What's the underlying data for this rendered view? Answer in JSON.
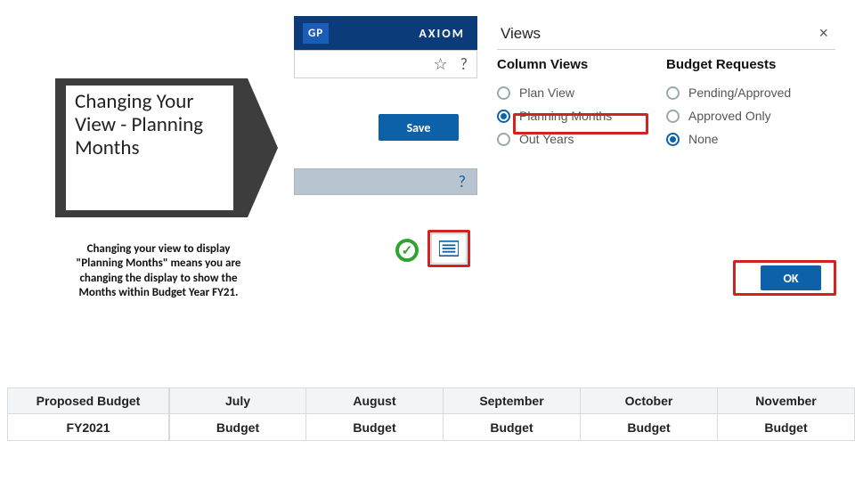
{
  "callout": {
    "title": "Changing Your View - Planning Months",
    "description": "Changing your view to display \"Planning Months\" means you are changing the display to show the Months within Budget Year FY21."
  },
  "app": {
    "badge": "GP",
    "brand": "AXIOM",
    "star_icon": "☆",
    "help_icon": "?",
    "save_label": "Save",
    "help2": "?"
  },
  "views": {
    "title": "Views",
    "close": "×",
    "column_views": {
      "heading": "Column Views",
      "options": [
        "Plan View",
        "Planning Months",
        "Out Years"
      ],
      "selected": 1
    },
    "budget_requests": {
      "heading": "Budget Requests",
      "options": [
        "Pending/Approved",
        "Approved Only",
        "None"
      ],
      "selected": 2
    },
    "ok_label": "OK"
  },
  "icons": {
    "check": "✓"
  },
  "table": {
    "headers": [
      "Proposed Budget",
      "July",
      "August",
      "September",
      "October",
      "November"
    ],
    "row": [
      "FY2021",
      "Budget",
      "Budget",
      "Budget",
      "Budget",
      "Budget"
    ]
  }
}
